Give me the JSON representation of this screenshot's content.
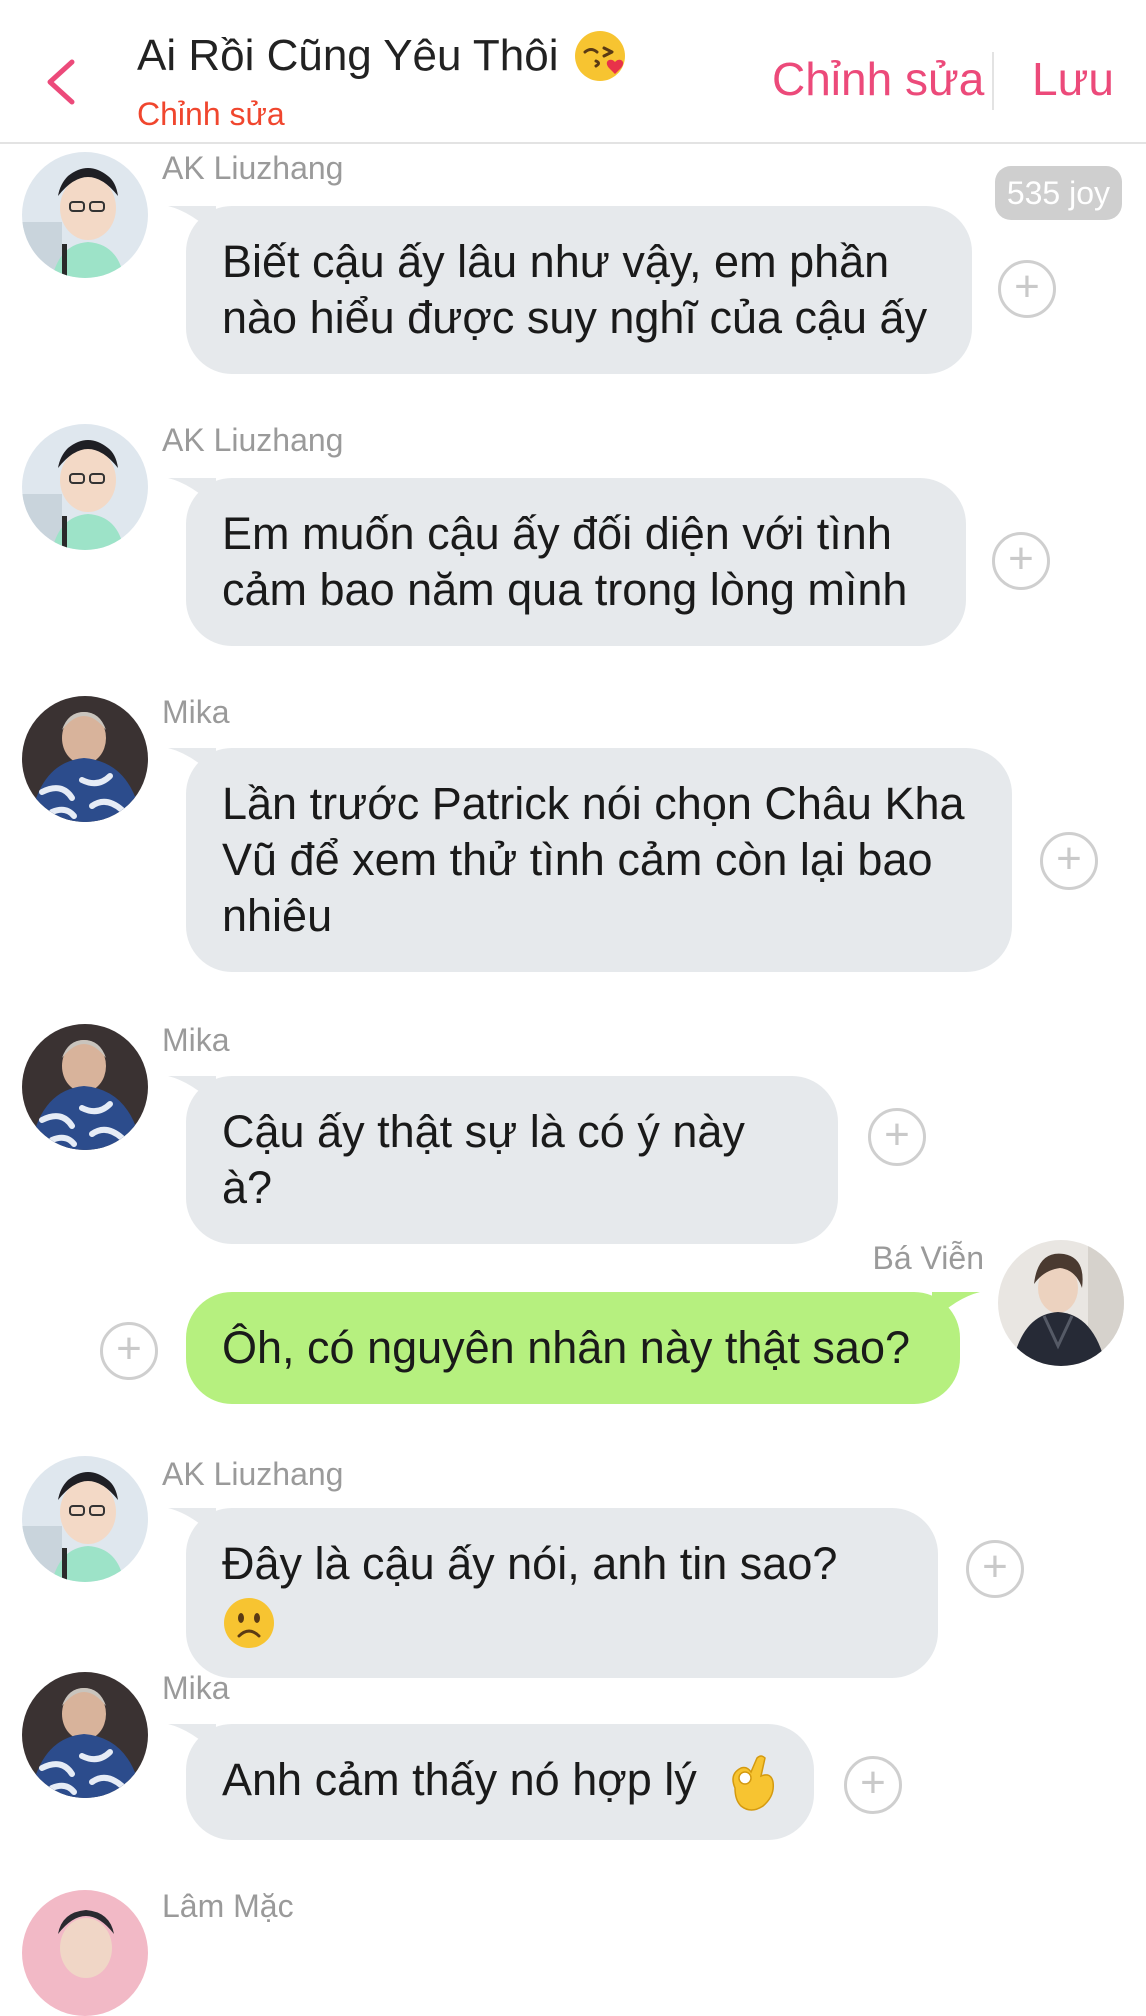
{
  "header": {
    "title": "Ai Rồi Cũng Yêu Thôi",
    "title_emoji": "kissing-face-with-heart",
    "subtitle": "Chỉnh sửa",
    "edit_label": "Chỉnh sửa",
    "save_label": "Lưu"
  },
  "badge": "535 joy",
  "messages": [
    {
      "sender": "AK Liuzhang",
      "text": "Biết cậu ấy lâu như vậy, em phần nào hiểu được suy nghĩ của cậu ấy",
      "side": "left"
    },
    {
      "sender": "AK Liuzhang",
      "text": "Em muốn cậu ấy đối diện với tình cảm bao năm qua trong lòng mình",
      "side": "left"
    },
    {
      "sender": "Mika",
      "text": "Lần trước Patrick nói chọn Châu Kha Vũ để xem thử tình cảm còn lại bao nhiêu",
      "side": "left"
    },
    {
      "sender": "Mika",
      "text": "Cậu ấy thật sự là có ý này à?",
      "side": "left"
    },
    {
      "sender": "Bá Viễn",
      "text": "Ôh, có nguyên nhân này thật sao?",
      "side": "right"
    },
    {
      "sender": "AK Liuzhang",
      "text": "Đây là cậu ấy nói, anh tin sao?",
      "emoji": "slightly-frowning-face",
      "side": "left"
    },
    {
      "sender": "Mika",
      "text": "Anh cảm thấy nó hợp lý",
      "emoji": "ok-hand",
      "side": "left"
    },
    {
      "sender": "Lâm Mặc",
      "side": "left"
    }
  ],
  "colors": {
    "accent": "#ec4a7a",
    "subtitle": "#f0462e",
    "bubble_in": "#e6e9ec",
    "bubble_out": "#b6f07f"
  }
}
